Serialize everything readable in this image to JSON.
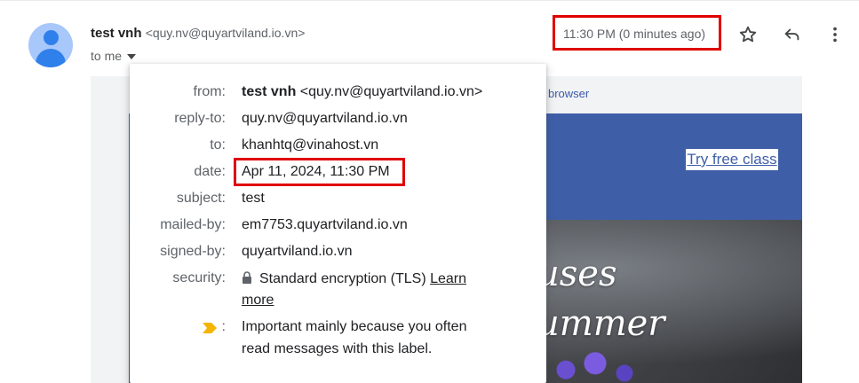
{
  "sender": {
    "name": "test vnh",
    "address": "<quy.nv@quyartviland.io.vn>",
    "to_line": "to me",
    "time": "11:30 PM (0 minutes ago)"
  },
  "actions": {
    "star": "star-icon",
    "reply": "reply-icon",
    "more": "more-vert-icon"
  },
  "email_body": {
    "browser_link": "browser",
    "cta": "Try free class",
    "hero_line1": "uses",
    "hero_line2": "ummer"
  },
  "details": {
    "from": {
      "label": "from:",
      "name": "test vnh",
      "address": "<quy.nv@quyartviland.io.vn>"
    },
    "reply_to": {
      "label": "reply-to:",
      "value": "quy.nv@quyartviland.io.vn"
    },
    "to": {
      "label": "to:",
      "value": "khanhtq@vinahost.vn"
    },
    "date": {
      "label": "date:",
      "value": "Apr 11, 2024, 11:30 PM"
    },
    "subject": {
      "label": "subject:",
      "value": "test"
    },
    "mailed_by": {
      "label": "mailed-by:",
      "value": "em7753.quyartviland.io.vn"
    },
    "signed_by": {
      "label": "signed-by:",
      "value": "quyartviland.io.vn"
    },
    "security": {
      "label": "security:",
      "value": "Standard encryption (TLS)",
      "link1": "Learn",
      "link2": "more"
    },
    "importance": {
      "label": ":",
      "line1": "Important mainly because you often",
      "line2": "read messages with this label."
    }
  },
  "colors": {
    "highlight": "#e00000",
    "hero": "#3f5ea8",
    "importance_marker": "#f4b400"
  }
}
